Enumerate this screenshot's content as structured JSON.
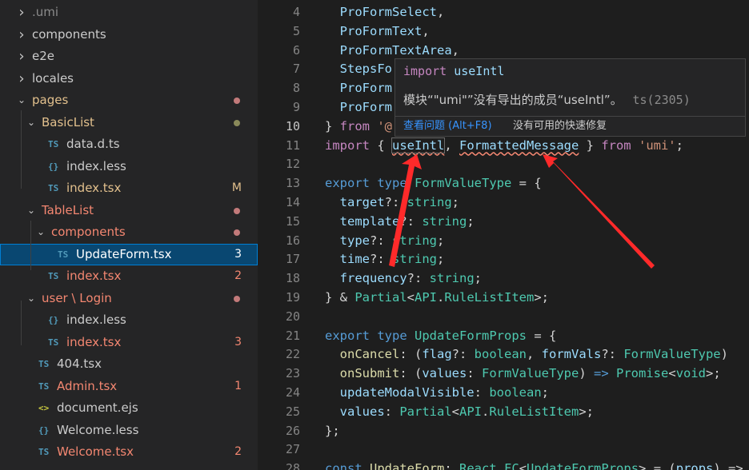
{
  "explorer": {
    "items": [
      {
        "label": ".umi",
        "kind": "folder",
        "expanded": false,
        "depth": 0,
        "color": "#8b8b8b"
      },
      {
        "label": "components",
        "kind": "folder",
        "expanded": false,
        "depth": 0,
        "color": "#cccccc"
      },
      {
        "label": "e2e",
        "kind": "folder",
        "expanded": false,
        "depth": 0,
        "color": "#cccccc"
      },
      {
        "label": "locales",
        "kind": "folder",
        "expanded": false,
        "depth": 0,
        "color": "#cccccc"
      },
      {
        "label": "pages",
        "kind": "folder",
        "expanded": true,
        "depth": 0,
        "color": "#e2c08d",
        "dot": "#c27a7a"
      },
      {
        "label": "BasicList",
        "kind": "folder",
        "expanded": true,
        "depth": 1,
        "color": "#e2c08d",
        "dot": "#8a8a5a"
      },
      {
        "label": "data.d.ts",
        "kind": "ts",
        "depth": 2,
        "color": "#cccccc"
      },
      {
        "label": "index.less",
        "kind": "less",
        "depth": 2,
        "color": "#cccccc"
      },
      {
        "label": "index.tsx",
        "kind": "ts",
        "depth": 2,
        "color": "#e2c08d",
        "badge": "M",
        "badgeColor": "#e2c08d"
      },
      {
        "label": "TableList",
        "kind": "folder",
        "expanded": true,
        "depth": 1,
        "color": "#f48771",
        "dot": "#c27a7a"
      },
      {
        "label": "components",
        "kind": "folder",
        "expanded": true,
        "depth": 2,
        "color": "#f48771",
        "dot": "#c27a7a"
      },
      {
        "label": "UpdateForm.tsx",
        "kind": "ts",
        "depth": 3,
        "color": "#ffffff",
        "badge": "3",
        "badgeColor": "#ffffff",
        "selected": true
      },
      {
        "label": "index.tsx",
        "kind": "ts",
        "depth": 2,
        "color": "#f48771",
        "badge": "2",
        "badgeColor": "#f48771"
      },
      {
        "label": "user \\ Login",
        "kind": "folder",
        "expanded": true,
        "depth": 1,
        "color": "#f48771",
        "dot": "#c27a7a"
      },
      {
        "label": "index.less",
        "kind": "less",
        "depth": 2,
        "color": "#cccccc"
      },
      {
        "label": "index.tsx",
        "kind": "ts",
        "depth": 2,
        "color": "#f48771",
        "badge": "3",
        "badgeColor": "#f48771"
      },
      {
        "label": "404.tsx",
        "kind": "ts",
        "depth": 1,
        "color": "#cccccc"
      },
      {
        "label": "Admin.tsx",
        "kind": "ts",
        "depth": 1,
        "color": "#f48771",
        "badge": "1",
        "badgeColor": "#f48771"
      },
      {
        "label": "document.ejs",
        "kind": "ejs",
        "depth": 1,
        "color": "#cccccc"
      },
      {
        "label": "Welcome.less",
        "kind": "less",
        "depth": 1,
        "color": "#cccccc"
      },
      {
        "label": "Welcome.tsx",
        "kind": "ts",
        "depth": 1,
        "color": "#f48771",
        "badge": "2",
        "badgeColor": "#f48771"
      }
    ],
    "icons": {
      "ts": "TS",
      "less": "{}",
      "ejs": "<>",
      "chevron_right": "›",
      "chevron_down": "⌄"
    }
  },
  "editor": {
    "active_line": 10,
    "lines": [
      {
        "n": 4,
        "tokens": [
          [
            "pl",
            "  "
          ],
          [
            "vr",
            "ProFormSelect"
          ],
          [
            "pl",
            ","
          ]
        ]
      },
      {
        "n": 5,
        "tokens": [
          [
            "pl",
            "  "
          ],
          [
            "vr",
            "ProFormText"
          ],
          [
            "pl",
            ","
          ]
        ]
      },
      {
        "n": 6,
        "tokens": [
          [
            "pl",
            "  "
          ],
          [
            "vr",
            "ProFormTextArea"
          ],
          [
            "pl",
            ","
          ]
        ]
      },
      {
        "n": 7,
        "tokens": [
          [
            "pl",
            "  "
          ],
          [
            "vr",
            "StepsFo"
          ]
        ]
      },
      {
        "n": 8,
        "tokens": [
          [
            "pl",
            "  "
          ],
          [
            "vr",
            "ProForm"
          ]
        ]
      },
      {
        "n": 9,
        "tokens": [
          [
            "pl",
            "  "
          ],
          [
            "vr",
            "ProForm"
          ]
        ]
      },
      {
        "n": 10,
        "tokens": [
          [
            "pl",
            "} "
          ],
          [
            "kw2",
            "from"
          ],
          [
            "pl",
            " "
          ],
          [
            "st",
            "'@"
          ]
        ]
      },
      {
        "n": 11,
        "tokens": [
          [
            "kw2",
            "import"
          ],
          [
            "pl",
            " { "
          ],
          [
            "vr",
            "useIntl",
            "err hl"
          ],
          [
            "pl",
            ", "
          ],
          [
            "vr",
            "FormattedMessage",
            "err"
          ],
          [
            "pl",
            " } "
          ],
          [
            "kw2",
            "from"
          ],
          [
            "pl",
            " "
          ],
          [
            "st",
            "'umi'"
          ],
          [
            "pl",
            ";"
          ]
        ]
      },
      {
        "n": 12,
        "tokens": []
      },
      {
        "n": 13,
        "tokens": [
          [
            "kw",
            "export"
          ],
          [
            "pl",
            " "
          ],
          [
            "kw",
            "type"
          ],
          [
            "pl",
            " "
          ],
          [
            "ty",
            "FormValueType"
          ],
          [
            "pl",
            " = {"
          ]
        ]
      },
      {
        "n": 14,
        "tokens": [
          [
            "pl",
            "  "
          ],
          [
            "vr",
            "target"
          ],
          [
            "pl",
            "?: "
          ],
          [
            "ty",
            "string"
          ],
          [
            "pl",
            ";"
          ]
        ]
      },
      {
        "n": 15,
        "tokens": [
          [
            "pl",
            "  "
          ],
          [
            "vr",
            "template"
          ],
          [
            "pl",
            "?: "
          ],
          [
            "ty",
            "string"
          ],
          [
            "pl",
            ";"
          ]
        ]
      },
      {
        "n": 16,
        "tokens": [
          [
            "pl",
            "  "
          ],
          [
            "vr",
            "type"
          ],
          [
            "pl",
            "?: "
          ],
          [
            "ty",
            "string"
          ],
          [
            "pl",
            ";"
          ]
        ]
      },
      {
        "n": 17,
        "tokens": [
          [
            "pl",
            "  "
          ],
          [
            "vr",
            "time"
          ],
          [
            "pl",
            "?: "
          ],
          [
            "ty",
            "string"
          ],
          [
            "pl",
            ";"
          ]
        ]
      },
      {
        "n": 18,
        "tokens": [
          [
            "pl",
            "  "
          ],
          [
            "vr",
            "frequency"
          ],
          [
            "pl",
            "?: "
          ],
          [
            "ty",
            "string"
          ],
          [
            "pl",
            ";"
          ]
        ]
      },
      {
        "n": 19,
        "tokens": [
          [
            "pl",
            "} & "
          ],
          [
            "ty",
            "Partial"
          ],
          [
            "pl",
            "<"
          ],
          [
            "ty",
            "API"
          ],
          [
            "pl",
            "."
          ],
          [
            "ty",
            "RuleListItem"
          ],
          [
            "pl",
            ">;"
          ]
        ]
      },
      {
        "n": 20,
        "tokens": []
      },
      {
        "n": 21,
        "tokens": [
          [
            "kw",
            "export"
          ],
          [
            "pl",
            " "
          ],
          [
            "kw",
            "type"
          ],
          [
            "pl",
            " "
          ],
          [
            "ty",
            "UpdateFormProps"
          ],
          [
            "pl",
            " = {"
          ]
        ]
      },
      {
        "n": 22,
        "tokens": [
          [
            "pl",
            "  "
          ],
          [
            "fn",
            "onCancel"
          ],
          [
            "pl",
            ": ("
          ],
          [
            "vr",
            "flag"
          ],
          [
            "pl",
            "?: "
          ],
          [
            "ty",
            "boolean"
          ],
          [
            "pl",
            ", "
          ],
          [
            "vr",
            "formVals"
          ],
          [
            "pl",
            "?: "
          ],
          [
            "ty",
            "FormValueType"
          ],
          [
            "pl",
            ")"
          ]
        ]
      },
      {
        "n": 23,
        "tokens": [
          [
            "pl",
            "  "
          ],
          [
            "fn",
            "onSubmit"
          ],
          [
            "pl",
            ": ("
          ],
          [
            "vr",
            "values"
          ],
          [
            "pl",
            ": "
          ],
          [
            "ty",
            "FormValueType"
          ],
          [
            "pl",
            ") "
          ],
          [
            "kw",
            "=>"
          ],
          [
            "pl",
            " "
          ],
          [
            "ty",
            "Promise"
          ],
          [
            "pl",
            "<"
          ],
          [
            "ty",
            "void"
          ],
          [
            "pl",
            ">;"
          ]
        ]
      },
      {
        "n": 24,
        "tokens": [
          [
            "pl",
            "  "
          ],
          [
            "vr",
            "updateModalVisible"
          ],
          [
            "pl",
            ": "
          ],
          [
            "ty",
            "boolean"
          ],
          [
            "pl",
            ";"
          ]
        ]
      },
      {
        "n": 25,
        "tokens": [
          [
            "pl",
            "  "
          ],
          [
            "vr",
            "values"
          ],
          [
            "pl",
            ": "
          ],
          [
            "ty",
            "Partial"
          ],
          [
            "pl",
            "<"
          ],
          [
            "ty",
            "API"
          ],
          [
            "pl",
            "."
          ],
          [
            "ty",
            "RuleListItem"
          ],
          [
            "pl",
            ">;"
          ]
        ]
      },
      {
        "n": 26,
        "tokens": [
          [
            "pl",
            "};"
          ]
        ]
      },
      {
        "n": 27,
        "tokens": []
      },
      {
        "n": 28,
        "tokens": [
          [
            "kw",
            "const"
          ],
          [
            "pl",
            " "
          ],
          [
            "fn",
            "UpdateForm"
          ],
          [
            "pl",
            ": "
          ],
          [
            "ty",
            "React"
          ],
          [
            "pl",
            "."
          ],
          [
            "ty",
            "FC"
          ],
          [
            "pl",
            "<"
          ],
          [
            "ty",
            "UpdateFormProps"
          ],
          [
            "pl",
            "> = ("
          ],
          [
            "vr",
            "props"
          ],
          [
            "pl",
            ") =>"
          ]
        ]
      }
    ]
  },
  "hover": {
    "signature_keyword": "import",
    "signature_name": "useIntl",
    "message": "模块“\"umi\"”没有导出的成员“useIntl”。",
    "code": "ts(2305)",
    "view_problem": "查看问题 (Alt+F8)",
    "no_quick_fix": "没有可用的快速修复"
  },
  "colors": {
    "arrow": "#ff2a2a",
    "link": "#3794ff"
  }
}
